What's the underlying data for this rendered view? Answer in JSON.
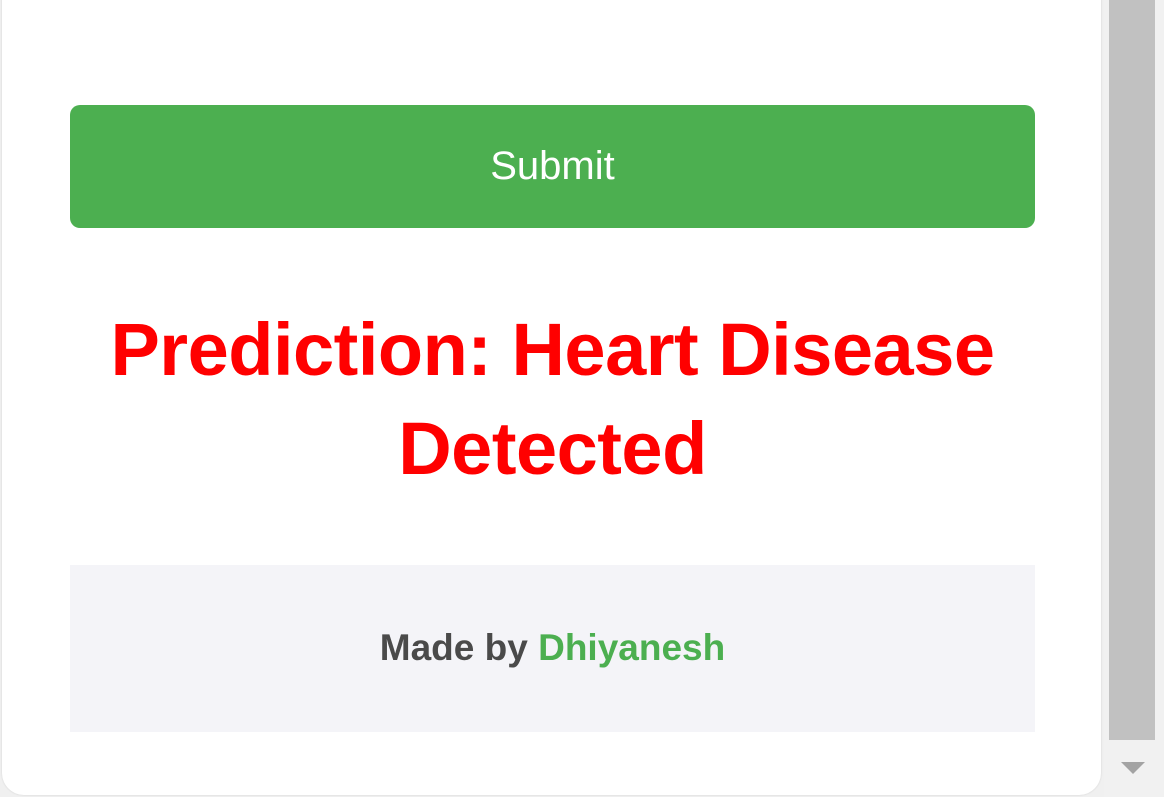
{
  "form": {
    "submit_label": "Submit"
  },
  "result": {
    "prediction_text": "Prediction: Heart Disease Detected"
  },
  "footer": {
    "made_by_label": "Made by",
    "author_name": "Dhiyanesh"
  },
  "colors": {
    "button_bg": "#4caf50",
    "prediction_text": "#ff0000",
    "footer_bg": "#f4f4f8",
    "author_text": "#4caf50",
    "footer_text": "#4a4a4a"
  },
  "icons": {
    "scroll_down": "triangle-down"
  }
}
